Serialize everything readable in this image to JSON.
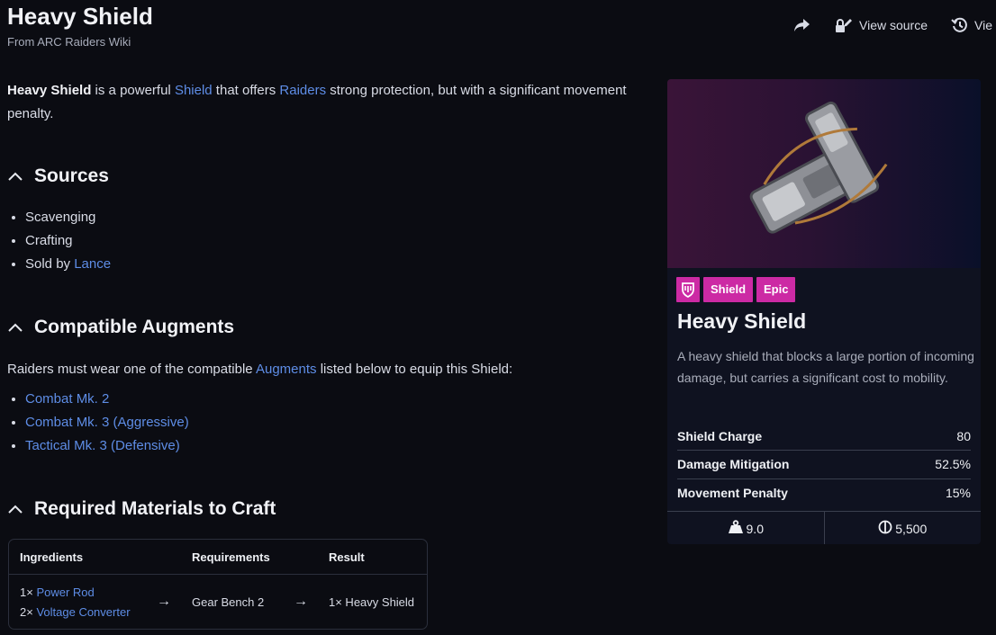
{
  "page": {
    "title": "Heavy Shield",
    "subtitle": "From ARC Raiders Wiki"
  },
  "actions": {
    "view_source": "View source",
    "view_history": "Vie"
  },
  "intro": {
    "bold": "Heavy Shield",
    "t1": " is a powerful ",
    "link1": "Shield",
    "t2": " that offers ",
    "link2": "Raiders",
    "t3": " strong protection, but with a significant movement penalty."
  },
  "sources": {
    "heading": "Sources",
    "items": [
      "Scavenging",
      "Crafting"
    ],
    "sold_prefix": "Sold by ",
    "sold_link": "Lance"
  },
  "augments": {
    "heading": "Compatible Augments",
    "para_t1": "Raiders must wear one of the compatible ",
    "para_link": "Augments",
    "para_t2": " listed below to equip this Shield:",
    "items": [
      "Combat Mk. 2",
      "Combat Mk. 3 (Aggressive)",
      "Tactical Mk. 3 (Defensive)"
    ]
  },
  "craft": {
    "heading": "Required Materials to Craft",
    "headers": [
      "Ingredients",
      "Requirements",
      "Result"
    ],
    "ingredients": [
      {
        "qty": "1×",
        "name": "Power Rod"
      },
      {
        "qty": "2×",
        "name": "Voltage Converter"
      }
    ],
    "requirement": "Gear Bench 2",
    "result": "1× Heavy Shield",
    "arrow": "→"
  },
  "card": {
    "badges": [
      "Shield",
      "Epic"
    ],
    "title": "Heavy Shield",
    "description": "A heavy shield that blocks a large portion of incoming damage, but carries a significant cost to mobility.",
    "stats": [
      {
        "label": "Shield Charge",
        "value": "80"
      },
      {
        "label": "Damage Mitigation",
        "value": "52.5%"
      },
      {
        "label": "Movement Penalty",
        "value": "15%"
      }
    ],
    "weight": "9.0",
    "price": "5,500"
  },
  "colors": {
    "accent_link": "#5e8de6",
    "badge": "#cc2aa4",
    "background": "#0b0c12"
  },
  "icons": [
    "share-icon",
    "lock-pencil-icon",
    "history-icon",
    "chevron-up-icon",
    "shield-badge-icon",
    "weight-icon",
    "coin-icon"
  ]
}
